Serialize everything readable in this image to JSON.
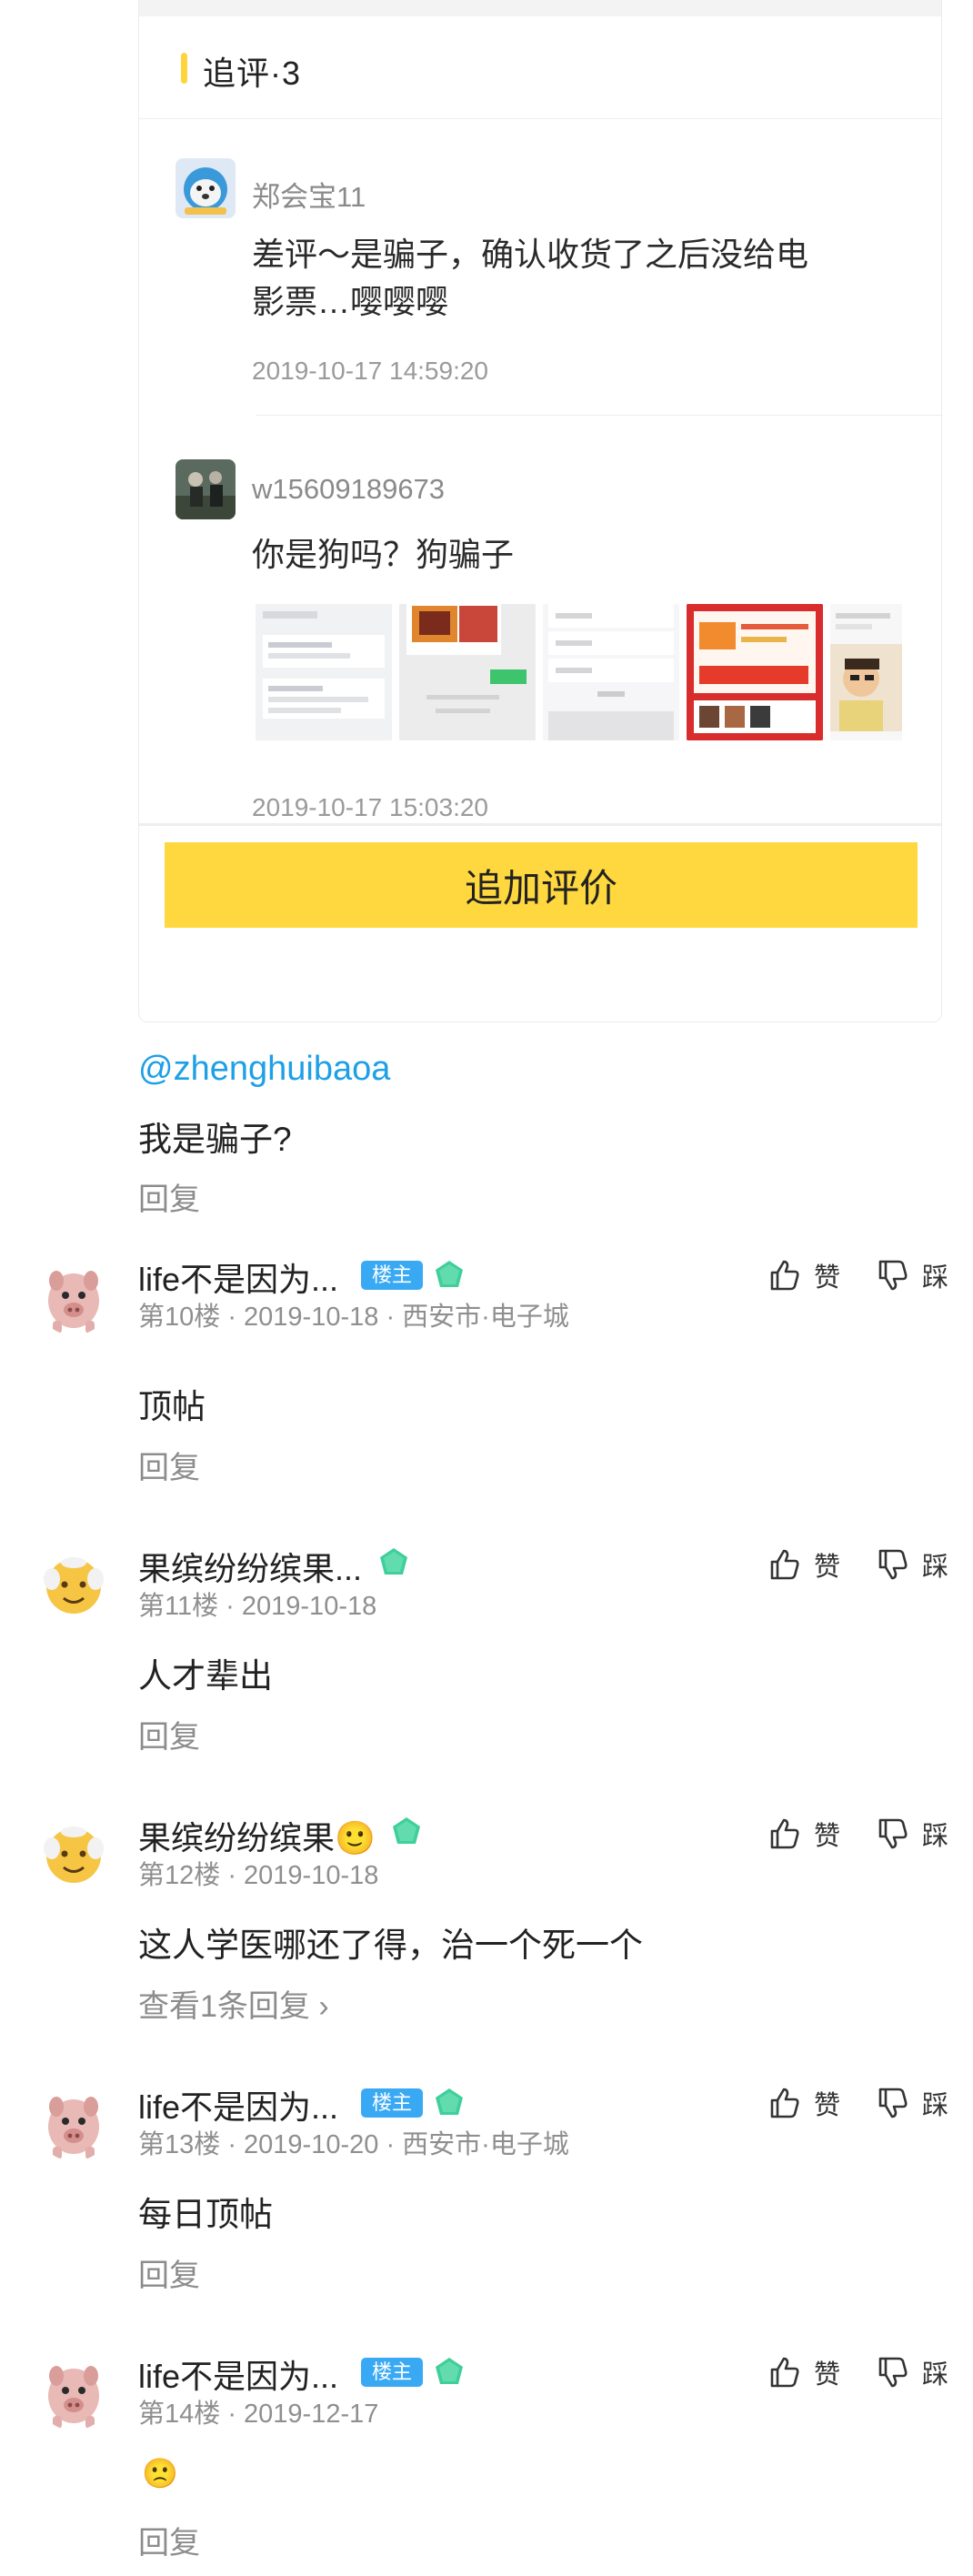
{
  "followup": {
    "title": "追评·3",
    "items": [
      {
        "name": "郑会宝11",
        "text": "差评～是骗子，确认收货了之后没给电影票…嘤嘤嘤",
        "time": "2019-10-17 14:59:20"
      },
      {
        "name": "w15609189673",
        "text": "你是狗吗？狗骗子",
        "time": "2019-10-17 15:03:20"
      }
    ],
    "add_button": "追加评价"
  },
  "first_comment": {
    "mention": "@zhenghuibaoa",
    "text": "我是骗子?",
    "reply": "回复"
  },
  "comments": [
    {
      "name": "life不是因为...",
      "host_badge": "楼主",
      "level": "3",
      "floor": "第10楼",
      "date": "2019-10-18",
      "location": "西安市·电子城",
      "text": "顶帖",
      "reply": "回复",
      "like": "赞",
      "dislike": "踩",
      "avatar": "pig"
    },
    {
      "name": "果缤纷纷缤果...",
      "level": "2",
      "floor": "第11楼",
      "date": "2019-10-18",
      "text": "人才辈出",
      "reply": "回复",
      "like": "赞",
      "dislike": "踩",
      "avatar": "old-man"
    },
    {
      "name": "果缤纷纷缤果🙂",
      "level": "2",
      "floor": "第12楼",
      "date": "2019-10-18",
      "text": "这人学医哪还了得，治一个死一个",
      "reply": "查看1条回复 ›",
      "like": "赞",
      "dislike": "踩",
      "avatar": "old-man"
    },
    {
      "name": "life不是因为...",
      "host_badge": "楼主",
      "level": "3",
      "floor": "第13楼",
      "date": "2019-10-20",
      "location": "西安市·电子城",
      "text": "每日顶帖",
      "reply": "回复",
      "like": "赞",
      "dislike": "踩",
      "avatar": "pig"
    },
    {
      "name": "life不是因为...",
      "host_badge": "楼主",
      "level": "3",
      "floor": "第14楼",
      "date": "2019-12-17",
      "text": "🙁",
      "reply": "回复",
      "like": "赞",
      "dislike": "踩",
      "avatar": "pig"
    }
  ],
  "colors": {
    "accent_yellow": "#ffd83f",
    "mention_blue": "#1ea0e6",
    "host_badge_blue": "#3aa9f4",
    "level_green": "#3fcf9a"
  }
}
